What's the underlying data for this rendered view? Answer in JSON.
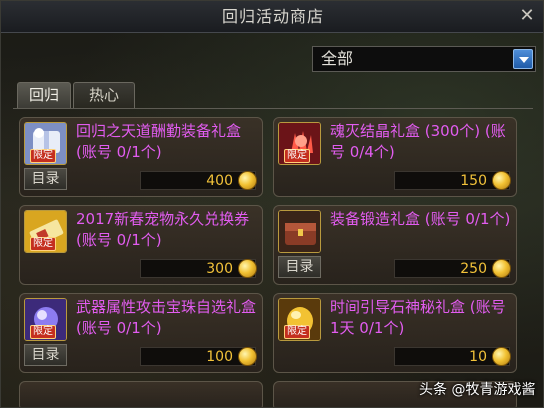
{
  "window": {
    "title": "回归活动商店"
  },
  "filter": {
    "selected": "全部"
  },
  "tabs": [
    {
      "label": "回归",
      "active": true
    },
    {
      "label": "热心",
      "active": false
    }
  ],
  "badge_text": "限定",
  "catalog_label": "目录",
  "items": [
    {
      "name": "回归之天道酬勤装备礼盒(账号 0/1个)",
      "price": "400",
      "icon": "gift-box-icon",
      "has_catalog": true
    },
    {
      "name": "魂灭结晶礼盒 (300个) (账号 0/4个)",
      "price": "150",
      "icon": "crystal-icon",
      "has_catalog": false
    },
    {
      "name": "2017新春宠物永久兑换券(账号 0/1个)",
      "price": "300",
      "icon": "pet-ticket-icon",
      "has_catalog": false
    },
    {
      "name": "装备锻造礼盒 (账号 0/1个)",
      "price": "250",
      "icon": "treasure-chest-icon",
      "has_catalog": true
    },
    {
      "name": "武器属性攻击宝珠自选礼盒(账号 0/1个)",
      "price": "100",
      "icon": "orb-icon",
      "has_catalog": true
    },
    {
      "name": "时间引导石神秘礼盒 (账号1天 0/1个)",
      "price": "10",
      "icon": "golden-stone-icon",
      "has_catalog": false
    }
  ],
  "watermark": "头条 @牧青游戏酱",
  "colors": {
    "item_name": "#e25cf0",
    "price": "#f2c23a",
    "accent": "#1f5ba8"
  }
}
